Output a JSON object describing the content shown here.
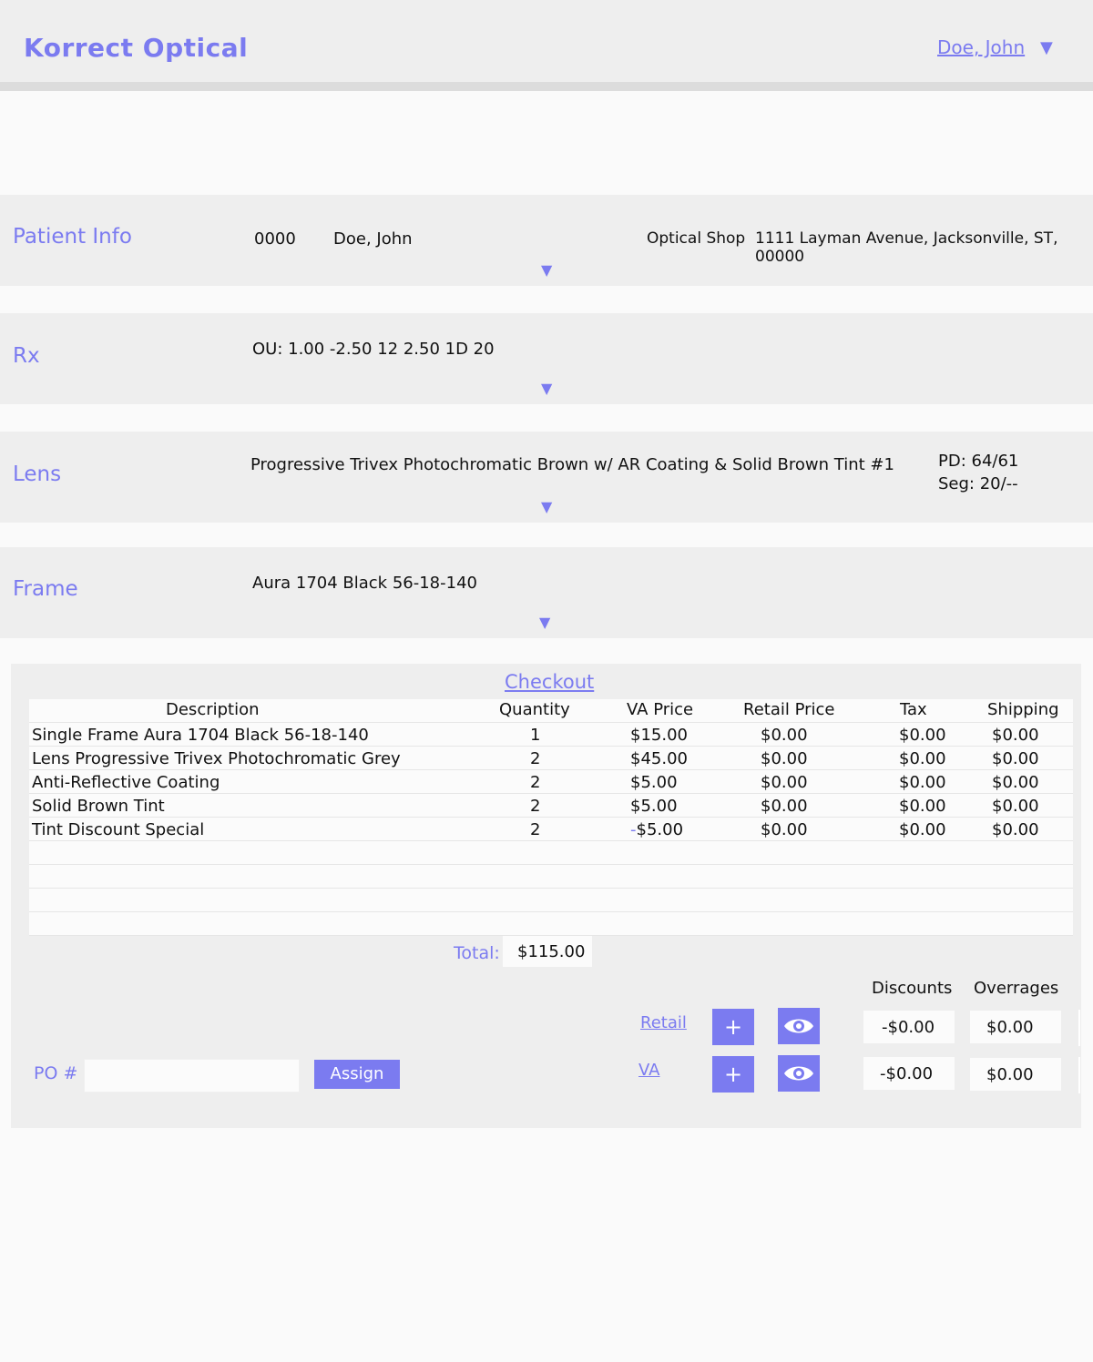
{
  "header": {
    "brand": "Korrect Optical",
    "user_name": "Doe, John",
    "user_caret": "▼"
  },
  "patient_info": {
    "title": "Patient Info",
    "id": "0000",
    "name": "Doe, John",
    "location_label": "Optical Shop",
    "address": "1111 Layman Avenue, Jacksonville, ST, 00000",
    "caret": "▼"
  },
  "rx": {
    "title": "Rx",
    "value": "OU: 1.00 -2.50 12 2.50 1D 20",
    "caret": "▼"
  },
  "lens": {
    "title": "Lens",
    "description": "Progressive Trivex Photochromatic Brown w/ AR Coating & Solid Brown Tint #1",
    "pd": "PD: 64/61",
    "seg": "Seg: 20/--",
    "caret": "▼"
  },
  "frame": {
    "title": "Frame",
    "description": "Aura 1704 Black 56-18-140",
    "caret": "▼"
  },
  "checkout": {
    "title": "Checkout",
    "columns": [
      "Description",
      "Quantity",
      "VA Price",
      "Retail Price",
      "Tax",
      "Shipping"
    ],
    "rows": [
      {
        "description": "Single Frame Aura 1704 Black 56-18-140",
        "quantity": "1",
        "va_price": "$15.00",
        "retail_price": "$0.00",
        "tax": "$0.00",
        "shipping": "$0.00"
      },
      {
        "description": "Lens Progressive Trivex Photochromatic Grey",
        "quantity": "2",
        "va_price": "$45.00",
        "retail_price": "$0.00",
        "tax": "$0.00",
        "shipping": "$0.00"
      },
      {
        "description": "Anti-Reflective Coating",
        "quantity": "2",
        "va_price": "$5.00",
        "retail_price": "$0.00",
        "tax": "$0.00",
        "shipping": "$0.00"
      },
      {
        "description": "Solid Brown Tint",
        "quantity": "2",
        "va_price": "$5.00",
        "retail_price": "$0.00",
        "tax": "$0.00",
        "shipping": "$0.00"
      },
      {
        "description": "Tint Discount Special",
        "quantity": "2",
        "va_price_sign": "-",
        "va_price": "$5.00",
        "retail_price": "$0.00",
        "tax": "$0.00",
        "shipping": "$0.00"
      }
    ],
    "total_label": "Total:",
    "total_value": "$115.00",
    "discounts_label": "Discounts",
    "overrages_label": "Overrages",
    "retail": {
      "link": "Retail",
      "add": "+",
      "discount": "-$0.00",
      "overrage": "$0.00"
    },
    "va": {
      "link": "VA",
      "add": "+",
      "discount": "-$0.00",
      "overrage": "$0.00"
    },
    "po_label": "PO #",
    "po_value": "",
    "assign_label": "Assign"
  },
  "colors": {
    "accent": "#7b7bf0",
    "band": "#eeeeee",
    "background": "#fafafa"
  },
  "icons": {
    "view": "eye-icon",
    "caret": "caret-down-icon"
  }
}
